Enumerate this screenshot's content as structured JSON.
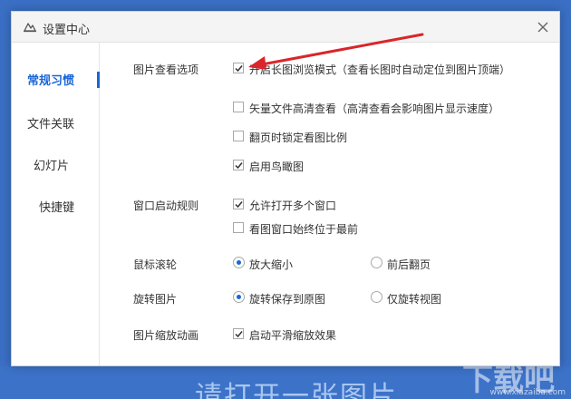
{
  "background": {
    "open_text": "请打开一张图片",
    "watermark": "下载吧",
    "watermark_url": "www.xiazaiba.com"
  },
  "dialog": {
    "title": "设置中心",
    "close_icon": "close-icon",
    "title_icon": "cloud-icon"
  },
  "sidebar": {
    "items": [
      {
        "label": "常规习惯",
        "active": true
      },
      {
        "label": "文件关联",
        "active": false
      },
      {
        "label": "幻灯片",
        "active": false
      },
      {
        "label": "快捷键",
        "active": false
      }
    ]
  },
  "sections": {
    "view": {
      "label": "图片查看选项",
      "options": [
        {
          "label": "开启长图浏览模式（查看长图时自动定位到图片顶端）",
          "checked": true
        },
        {
          "label": "矢量文件高清查看（高清查看会影响图片显示速度）",
          "checked": false
        },
        {
          "label": "翻页时锁定看图比例",
          "checked": false
        },
        {
          "label": "启用鸟瞰图",
          "checked": true
        }
      ]
    },
    "window": {
      "label": "窗口启动规则",
      "options": [
        {
          "label": "允许打开多个窗口",
          "checked": true
        },
        {
          "label": "看图窗口始终位于最前",
          "checked": false
        }
      ]
    },
    "wheel": {
      "label": "鼠标滚轮",
      "options": [
        {
          "label": "放大缩小",
          "selected": true
        },
        {
          "label": "前后翻页",
          "selected": false
        }
      ]
    },
    "rotate": {
      "label": "旋转图片",
      "options": [
        {
          "label": "旋转保存到原图",
          "selected": true
        },
        {
          "label": "仅旋转视图",
          "selected": false
        }
      ]
    },
    "zoom_anim": {
      "label": "图片缩放动画",
      "options": [
        {
          "label": "启动平滑缩放效果",
          "checked": true
        }
      ]
    }
  },
  "colors": {
    "accent": "#1a66d8",
    "annotation_arrow": "#d9262b",
    "background": "#3a6fc4"
  }
}
